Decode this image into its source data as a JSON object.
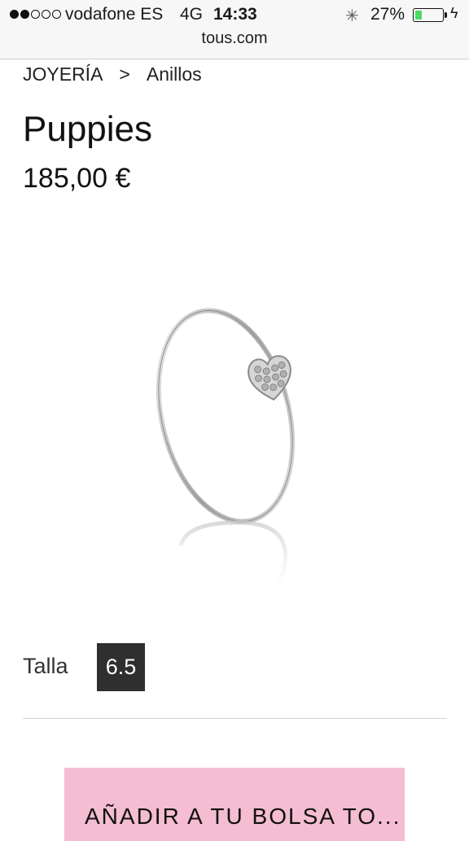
{
  "status_bar": {
    "carrier": "vodafone ES",
    "network": "4G",
    "time": "14:33",
    "battery_percent": "27%",
    "battery_level": 0.27,
    "signal_bars_filled": 2,
    "signal_bars_total": 5,
    "icons": [
      "signal-dots-icon",
      "loading-spinner-icon",
      "battery-icon",
      "charging-bolt-icon"
    ]
  },
  "browser": {
    "url": "tous.com"
  },
  "breadcrumb": {
    "parent": "JOYERÍA",
    "separator": ">",
    "current": "Anillos"
  },
  "product": {
    "name": "Puppies",
    "price": "185,00 €",
    "image": "ring-with-heart-pave-image"
  },
  "size": {
    "label": "Talla",
    "selected": "6.5"
  },
  "cta": {
    "label": "AÑADIR A TU BOLSA TO...",
    "color": "#f4bdd2"
  }
}
